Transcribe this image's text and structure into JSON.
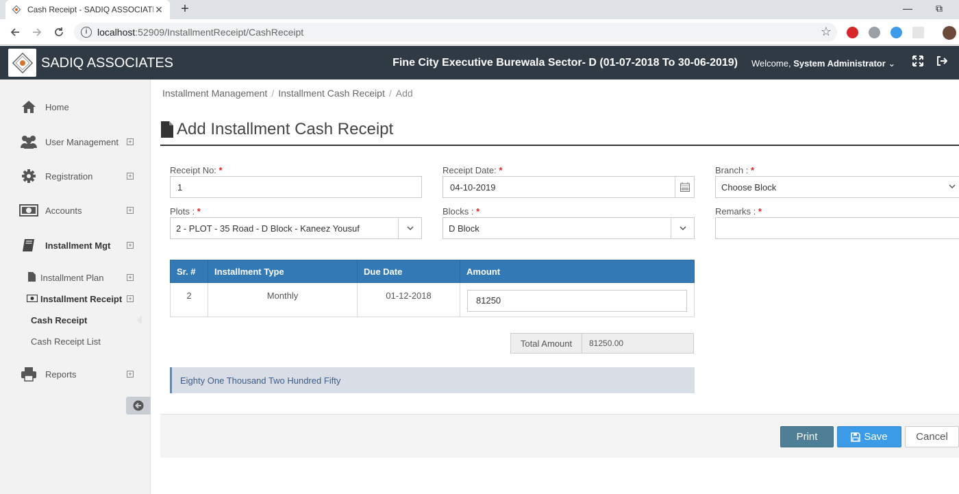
{
  "browser": {
    "tab_title": "Cash Receipt - SADIQ ASSOCIATES",
    "url_host": "localhost",
    "url_path": ":52909/InstallmentReceipt/CashReceipt",
    "new_tab": "+",
    "close": "✕"
  },
  "header": {
    "brand": "SADIQ ASSOCIATES",
    "project": "Fine City Executive Burewala Sector- D (01-07-2018 To 30-06-2019)",
    "welcome_prefix": "Welcome,",
    "user": "System Administrator"
  },
  "sidebar": {
    "items": [
      {
        "label": "Home",
        "icon": "home-icon"
      },
      {
        "label": "User Management",
        "icon": "users-icon"
      },
      {
        "label": "Registration",
        "icon": "gear-icon"
      },
      {
        "label": "Accounts",
        "icon": "money-icon"
      },
      {
        "label": "Installment Mgt",
        "icon": "book-icon"
      },
      {
        "label": "Reports",
        "icon": "printer-icon"
      }
    ],
    "subitems": [
      {
        "label": "Installment Plan",
        "icon": "file-icon"
      },
      {
        "label": "Installment Receipt",
        "icon": "money-icon"
      },
      {
        "label": "Cash Receipt"
      },
      {
        "label": "Cash Receipt List"
      }
    ]
  },
  "breadcrumb": [
    "Installment Management",
    "Installment Cash Receipt",
    "Add"
  ],
  "page": {
    "title": "Add Installment Cash Receipt"
  },
  "form": {
    "receipt_no": {
      "label": "Receipt No:",
      "value": "1"
    },
    "receipt_date": {
      "label": "Receipt Date:",
      "value": "04-10-2019"
    },
    "branch": {
      "label": "Branch :",
      "value": "Choose Block"
    },
    "plots": {
      "label": "Plots :",
      "value": "2 - PLOT - 35 Road - D Block - Kaneez Yousuf"
    },
    "blocks": {
      "label": "Blocks :",
      "value": "D Block"
    },
    "remarks": {
      "label": "Remarks :",
      "value": ""
    },
    "required_mark": "*"
  },
  "table": {
    "headers": [
      "Sr. #",
      "Installment Type",
      "Due Date",
      "Amount"
    ],
    "rows": [
      {
        "sr": "2",
        "type": "Monthly",
        "due_date": "01-12-2018",
        "amount": "81250"
      }
    ]
  },
  "totals": {
    "label": "Total Amount",
    "value": "81250.00"
  },
  "amount_in_words": "Eighty One Thousand Two Hundred Fifty",
  "buttons": {
    "print": "Print",
    "save": "Save",
    "cancel": "Cancel"
  },
  "colors": {
    "header_bg": "#2f3a45",
    "table_header": "#3379b5",
    "save": "#3b9be6",
    "print": "#4e7f97"
  }
}
